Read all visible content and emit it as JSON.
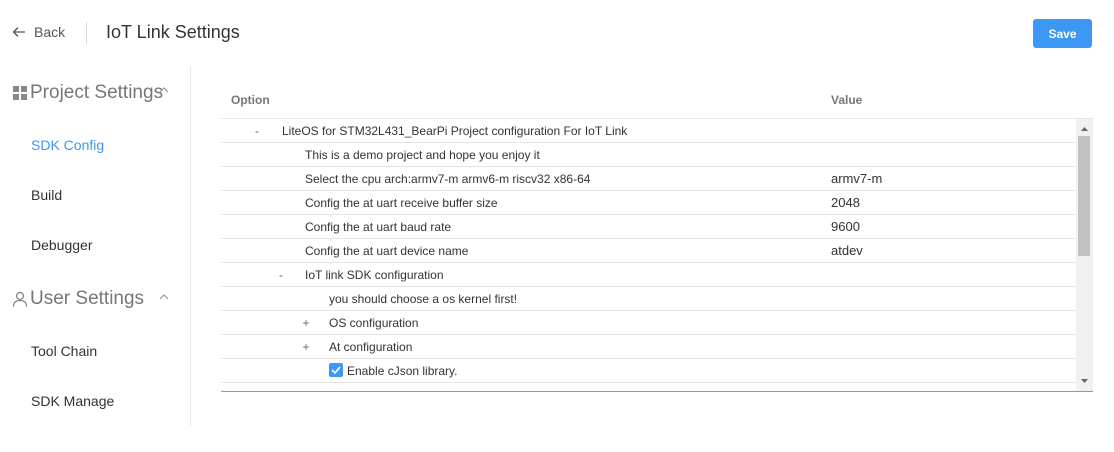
{
  "header": {
    "back_label": "Back",
    "title": "IoT Link Settings",
    "save_label": "Save"
  },
  "colors": {
    "accent": "#3d98f5",
    "sidebar_divider": "#e8e8e8"
  },
  "sidebar": {
    "groups": [
      {
        "label": "Project Settings",
        "icon": "grid-icon",
        "expanded": true,
        "items": [
          {
            "label": "SDK Config",
            "active": true
          },
          {
            "label": "Build"
          },
          {
            "label": "Debugger"
          }
        ]
      },
      {
        "label": "User Settings",
        "icon": "user-icon",
        "expanded": true,
        "items": [
          {
            "label": "Tool Chain"
          },
          {
            "label": "SDK Manage"
          }
        ]
      }
    ]
  },
  "table": {
    "columns": {
      "option": "Option",
      "value": "Value"
    },
    "rows": [
      {
        "toggle": "-",
        "option": "LiteOS for STM32L431_BearPi Project configuration For IoT Link",
        "value": ""
      },
      {
        "toggle": "",
        "option": "This is a demo project and hope you enjoy it",
        "value": ""
      },
      {
        "toggle": "",
        "option": "Select the cpu arch:armv7-m armv6-m riscv32 x86-64",
        "value": "armv7-m"
      },
      {
        "toggle": "",
        "option": "Config the at uart receive buffer size",
        "value": "2048"
      },
      {
        "toggle": "",
        "option": "Config the at uart baud rate",
        "value": "9600"
      },
      {
        "toggle": "",
        "option": "Config the at uart device name",
        "value": "atdev"
      },
      {
        "toggle": "-",
        "option": "IoT link SDK configuration",
        "value": ""
      },
      {
        "toggle": "",
        "option": "you should choose a os kernel first!",
        "value": ""
      },
      {
        "toggle": "+",
        "option": "OS configuration",
        "value": ""
      },
      {
        "toggle": "+",
        "option": "At configuration",
        "value": ""
      },
      {
        "toggle": "",
        "option": "Enable cJson library.",
        "value": "",
        "checked": true
      }
    ]
  }
}
